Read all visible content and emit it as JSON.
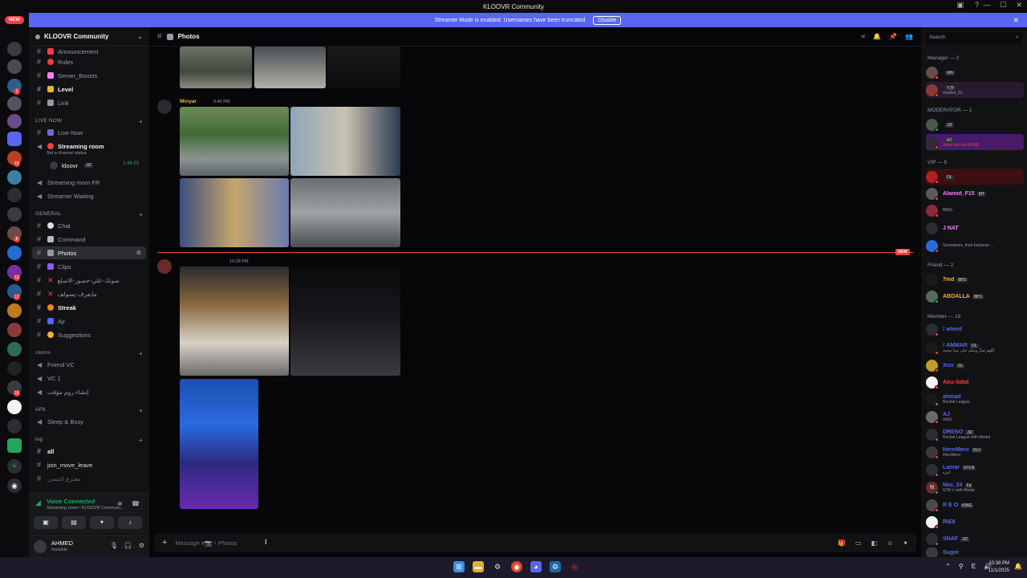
{
  "window": {
    "title": "KLOOVR Community",
    "controls": [
      "—",
      "☐",
      "✕"
    ],
    "extra_icons": [
      "inbox-icon",
      "help-icon"
    ]
  },
  "banner": {
    "text": "Streamer Mode is enabled. Usernames have been truncated.",
    "button": "Disable",
    "close": "✕"
  },
  "guild_bar": {
    "new_label": "NEW",
    "badges": [
      "2",
      "18",
      "8",
      "12",
      "17",
      "16"
    ]
  },
  "server": {
    "name": "KLOOVR Community",
    "channels_top": [
      {
        "name": "Announcement",
        "kind": "text"
      },
      {
        "name": "Rules",
        "kind": "text"
      },
      {
        "name": "Server_Boosts",
        "kind": "text"
      },
      {
        "name": "Level",
        "kind": "text",
        "bold": true
      },
      {
        "name": "Link",
        "kind": "text"
      }
    ],
    "live_now": {
      "title": "LIVE NOW",
      "channels": [
        {
          "name": "Live-Now",
          "kind": "text"
        },
        {
          "name": "Streaming room",
          "kind": "voice",
          "status": "Set a channel status",
          "timer": "1:46:23",
          "user": "kloovr",
          "user_tag": "JIZ"
        },
        {
          "name": "Streaming room FR",
          "kind": "voice"
        },
        {
          "name": "Streamer Waiting",
          "kind": "voice"
        }
      ]
    },
    "general": {
      "title": "GENERAL",
      "channels": [
        {
          "name": "Chat",
          "kind": "text"
        },
        {
          "name": "Command",
          "kind": "text"
        },
        {
          "name": "Photos",
          "kind": "text",
          "active": true
        },
        {
          "name": "Clips",
          "kind": "text"
        },
        {
          "name": "صوتك-علي-خصور-الاصلع",
          "kind": "text"
        },
        {
          "name": "مايعرف-يسولف",
          "kind": "text"
        },
        {
          "name": "Streak",
          "kind": "text",
          "bold": true
        },
        {
          "name": "Ajr",
          "kind": "text"
        },
        {
          "name": "Suggestions",
          "kind": "text"
        }
      ]
    },
    "rooms": {
      "title": "rooms",
      "channels": [
        {
          "name": "Friend VC",
          "kind": "voice"
        },
        {
          "name": "VC 1",
          "kind": "voice"
        },
        {
          "name": "إنشاء روم مؤقت",
          "kind": "voice"
        }
      ]
    },
    "afk": {
      "title": "AFK",
      "channels": [
        {
          "name": "Sleep & Busy",
          "kind": "voice"
        }
      ]
    },
    "log": {
      "title": "log",
      "channels": [
        {
          "name": "all",
          "kind": "text",
          "bold": true
        },
        {
          "name": "join_move_leave",
          "kind": "text"
        },
        {
          "name": "معترع المسن",
          "kind": "text"
        }
      ]
    }
  },
  "voice_panel": {
    "title": "Voice Connected",
    "subtitle": "Streaming room / KLOOVR Communi..."
  },
  "user_panel": {
    "name": "AHMED",
    "status": "Invisible"
  },
  "channel_header": {
    "name": "Photos"
  },
  "messages": [
    {
      "author": "Minyar",
      "time": "9:46 PM"
    },
    {
      "author": "",
      "time": "10:28 PM"
    }
  ],
  "new_label": "NEW",
  "composer": {
    "placeholder": "Message #📷・Photos"
  },
  "members": {
    "search_placeholder": "Search",
    "groups": [
      {
        "title": "Manager — 2",
        "members": [
          {
            "name": "",
            "tag": "shh",
            "activity": "",
            "color": "#f2f3f5"
          },
          {
            "name": "",
            "tag": "YJY",
            "activity": "shaden_52",
            "color": "#f2f3f5"
          }
        ]
      },
      {
        "title": "MODERATOR — 2",
        "members": [
          {
            "name": "",
            "tag": "JIZ",
            "activity": "",
            "color": "#f23f42"
          },
          {
            "name": "",
            "tag": "bO",
            "activity": "Silent but not BLIND",
            "color": "#f2f3f5"
          }
        ]
      },
      {
        "title": "VIP — 5",
        "members": [
          {
            "name": "",
            "tag": "OL",
            "activity": "",
            "color": "#f23f42"
          },
          {
            "name": "Alanod_F15",
            "tag": "MT",
            "activity": "",
            "color": "#f47fff"
          },
          {
            "name": "",
            "tag": "",
            "activity": "BRKL",
            "color": "#f2f3f5"
          },
          {
            "name": "J NAT",
            "tag": "",
            "activity": "",
            "color": "#f47fff"
          },
          {
            "name": "",
            "tag": "",
            "activity": "Sometimes, their behavior ...",
            "color": "#f2f3f5"
          }
        ]
      },
      {
        "title": "Friend — 2",
        "members": [
          {
            "name": "7md",
            "tag": "88'S",
            "activity": "",
            "color": "#f0b232"
          },
          {
            "name": "ABDALLA",
            "tag": "88'S",
            "activity": "",
            "color": "#f0b232"
          }
        ]
      },
      {
        "title": "Member — 16",
        "members": [
          {
            "name": "! wleed",
            "tag": "",
            "activity": "",
            "color": "#5865f2"
          },
          {
            "name": "! AMMAR",
            "tag": "OL",
            "activity": "اللهم صلِّ وسلِّم على نبينا محمد",
            "color": "#5865f2"
          },
          {
            "name": "3nzi",
            "tag": "OL",
            "activity": "",
            "color": "#5865f2"
          },
          {
            "name": "Abu-3abd",
            "tag": "",
            "activity": "",
            "color": "#f23f42"
          },
          {
            "name": "ahmad",
            "tag": "",
            "activity": "Rocket League",
            "color": "#5865f2"
          },
          {
            "name": "AJ",
            "tag": "",
            "activity": "shAJ",
            "color": "#5865f2"
          },
          {
            "name": "DRENO",
            "tag": "JIZ",
            "activity": "Rocket League with Medal",
            "color": "#5865f2"
          },
          {
            "name": "HeroMero",
            "tag": "2LU",
            "activity": "HeroMero",
            "color": "#5865f2"
          },
          {
            "name": "Lamar",
            "tag": "SYLN",
            "activity": "امزه",
            "color": "#5865f2"
          },
          {
            "name": "Nas_24",
            "tag": "Fa",
            "activity": "GTA V with Medal",
            "color": "#5865f2"
          },
          {
            "name": "R E O",
            "tag": "KING",
            "activity": "",
            "color": "#5865f2"
          },
          {
            "name": "RIE8",
            "tag": "",
            "activity": "",
            "color": "#5865f2"
          },
          {
            "name": "SNAF",
            "tag": "JIZ",
            "activity": "",
            "color": "#5865f2"
          },
          {
            "name": "Sugor",
            "tag": "",
            "activity": "",
            "color": "#5865f2"
          }
        ]
      }
    ]
  },
  "taskbar": {
    "time": "10:38 PM",
    "date": "11/1/2025"
  },
  "colors": {
    "accent": "#5865f2",
    "online": "#23a55a",
    "dnd": "#f23f42",
    "idle": "#f0b232"
  }
}
